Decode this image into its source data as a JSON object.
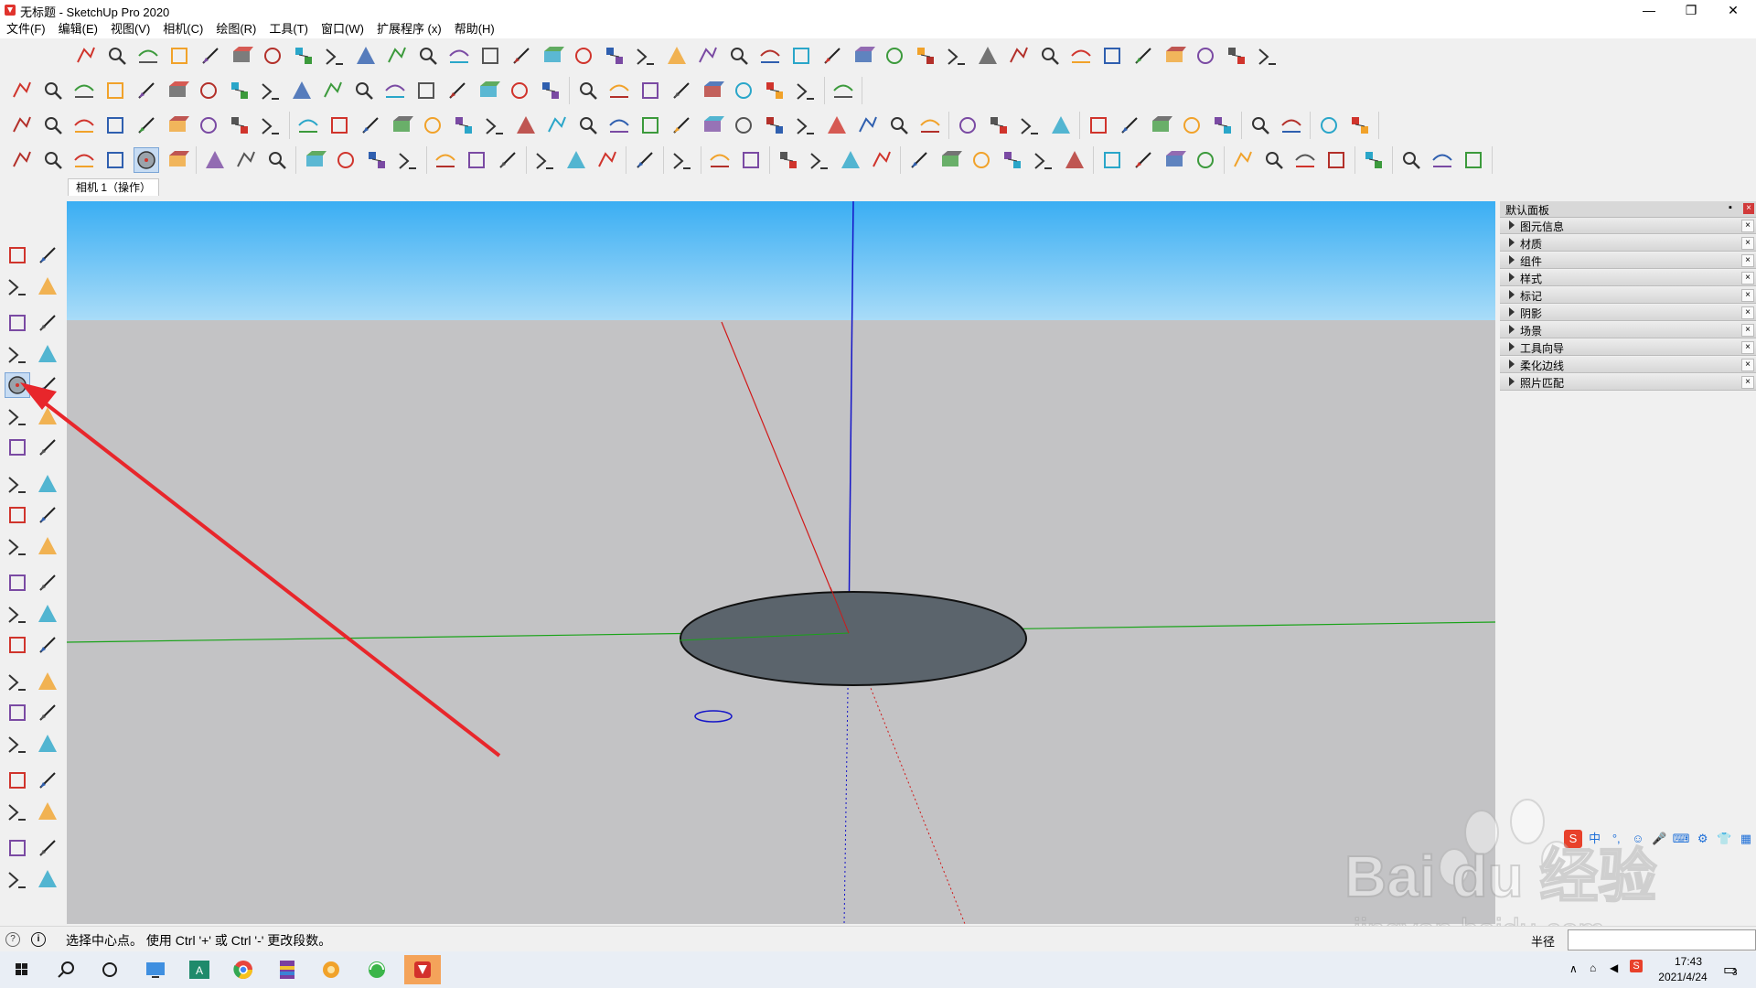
{
  "window": {
    "title": "无标题 - SketchUp Pro 2020",
    "controls": [
      "—",
      "❐",
      "✕"
    ]
  },
  "menu": [
    "文件(F)",
    "编辑(E)",
    "视图(V)",
    "相机(C)",
    "绘图(R)",
    "工具(T)",
    "窗口(W)",
    "扩展程序 (x)",
    "帮助(H)"
  ],
  "scene_tab": "相机 1（操作）",
  "tray": {
    "title": "默认面板",
    "pin": "▪",
    "close": "×",
    "items": [
      "图元信息",
      "材质",
      "组件",
      "样式",
      "标记",
      "阴影",
      "场景",
      "工具向导",
      "柔化边线",
      "照片匹配"
    ]
  },
  "status": {
    "text": "选择中心点。 使用 Ctrl '+' 或 Ctrl '-' 更改段数。",
    "info1": "?",
    "info2": "i",
    "radius_label": "半径",
    "vcb_value": ""
  },
  "taskbar": {
    "time": "17:43",
    "date": "2021/4/24",
    "notification_count": "3"
  },
  "ime": [
    "中",
    "°,",
    "☺",
    "🎤",
    "⌨",
    "⚙",
    "👕",
    "▦"
  ],
  "watermark": {
    "brand": "Bai du 经验",
    "url": "jingyan.baidu.com"
  },
  "colors": {
    "accent_arrow": "#e8262b",
    "sky_top": "#3aaef3",
    "ground": "#c3c3c5",
    "disk_fill": "#5b646c",
    "axis_red": "#d11818",
    "axis_green": "#19a319",
    "axis_blue": "#1414c8"
  }
}
